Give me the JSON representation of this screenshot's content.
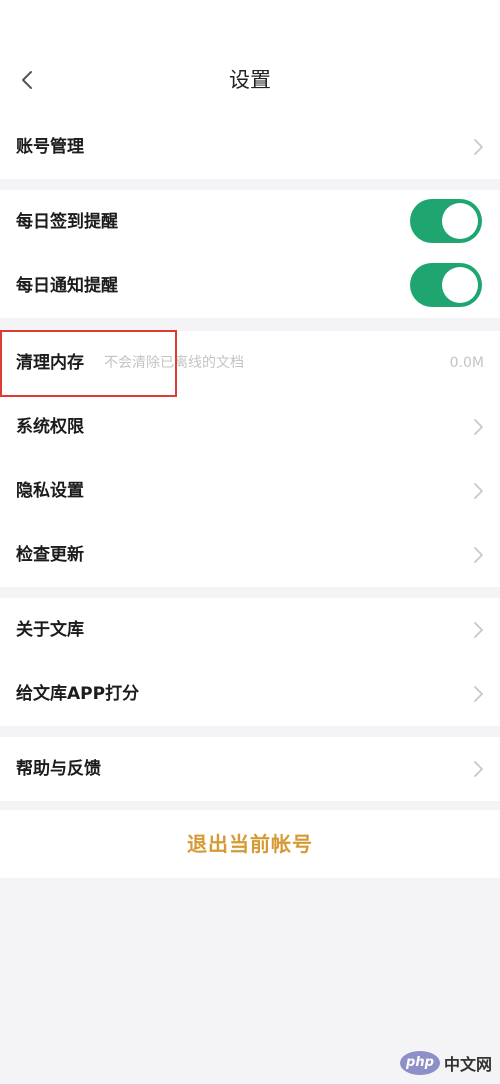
{
  "header": {
    "title": "设置",
    "back_icon": "chevron-left-icon"
  },
  "sections": {
    "account": {
      "label": "账号管理"
    },
    "reminders": {
      "daily_checkin": {
        "label": "每日签到提醒",
        "enabled": true
      },
      "daily_notify": {
        "label": "每日通知提醒",
        "enabled": true
      }
    },
    "system": {
      "clear_cache": {
        "label": "清理内存",
        "hint": "不会清除已离线的文档",
        "value": "0.0M"
      },
      "permissions": {
        "label": "系统权限"
      },
      "privacy": {
        "label": "隐私设置"
      },
      "update": {
        "label": "检查更新"
      }
    },
    "about": {
      "about_library": {
        "label": "关于文库"
      },
      "rate_app": {
        "label": "给文库APP打分"
      }
    },
    "help": {
      "feedback": {
        "label": "帮助与反馈"
      }
    }
  },
  "logout": {
    "label": "退出当前帐号"
  },
  "watermark": {
    "logo": "php",
    "text": "中文网"
  },
  "colors": {
    "accent_toggle": "#1fa570",
    "logout": "#d59a35",
    "highlight": "#e03a34"
  }
}
